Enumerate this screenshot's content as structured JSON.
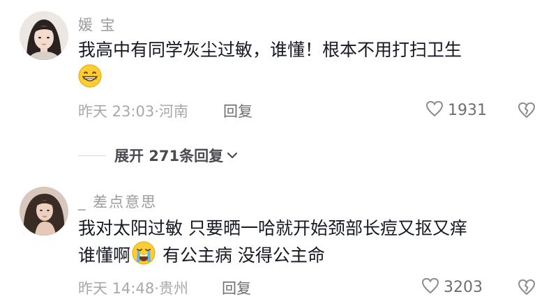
{
  "comments": [
    {
      "username": "媛 宝",
      "text_line1": "我高中有同学灰尘过敏，谁懂！根本不用打扫卫生",
      "emoji": "grinning-face-emoji",
      "time": "昨天 23:03",
      "location_sep": "·",
      "location": "河南",
      "reply_label": "回复",
      "likes": "1931",
      "expand_label": "展开 271条回复"
    },
    {
      "username": "_ 差点意思",
      "text_line1": "我对太阳过敏 只要晒一哈就开始颈部长痘又抠又痒",
      "text_line2_a": "谁懂啊",
      "emoji": "crying-face-emoji",
      "text_line2_b": " 有公主病 没得公主命",
      "time": "昨天 14:48",
      "location_sep": "·",
      "location": "贵州",
      "reply_label": "回复",
      "likes": "3203"
    }
  ],
  "colors": {
    "text": "#161823",
    "meta": "#a8a8ac",
    "username": "#9b9ba0",
    "icon": "#6e6e73"
  }
}
